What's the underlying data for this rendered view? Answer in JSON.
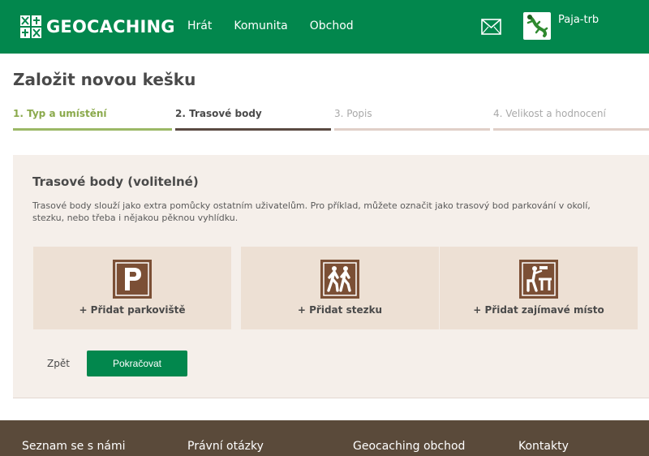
{
  "header": {
    "logo_text": "GEOCACHING",
    "nav": [
      {
        "label": "Hrát"
      },
      {
        "label": "Komunita"
      },
      {
        "label": "Obchod"
      }
    ],
    "username": "Paja-trb"
  },
  "page": {
    "title": "Založit novou kešku"
  },
  "steps": [
    {
      "label": "1. Typ a umístění",
      "state": "completed"
    },
    {
      "label": "2. Trasové body",
      "state": "active"
    },
    {
      "label": "3. Popis",
      "state": "upcoming"
    },
    {
      "label": "4. Velikost a hodnocení",
      "state": "upcoming"
    }
  ],
  "panel": {
    "title": "Trasové body (volitelné)",
    "description": "Trasové body slouží jako extra pomůcky ostatním uživatelům. Pro příklad, můžete označit jako trasový bod parkování v okolí, stezku, nebo třeba i nějakou pěknou vyhlídku.",
    "cards": [
      {
        "label": "+ Přidat parkoviště",
        "icon": "parking-icon"
      },
      {
        "label": "+ Přidat stezku",
        "icon": "hiking-icon"
      },
      {
        "label": "+ Přidat zajímavé místo",
        "icon": "picnic-icon"
      }
    ],
    "back_label": "Zpět",
    "continue_label": "Pokračovat"
  },
  "footer": {
    "links": [
      {
        "label": "Seznam se s námi"
      },
      {
        "label": "Právní otázky"
      },
      {
        "label": "Geocaching obchod"
      },
      {
        "label": "Kontakty"
      }
    ]
  },
  "colors": {
    "brand_green": "#02874d",
    "icon_brown": "#7b4f35",
    "panel_bg": "#f5efea",
    "card_bg": "#ede0d4",
    "footer_bg": "#5a4a3a"
  }
}
